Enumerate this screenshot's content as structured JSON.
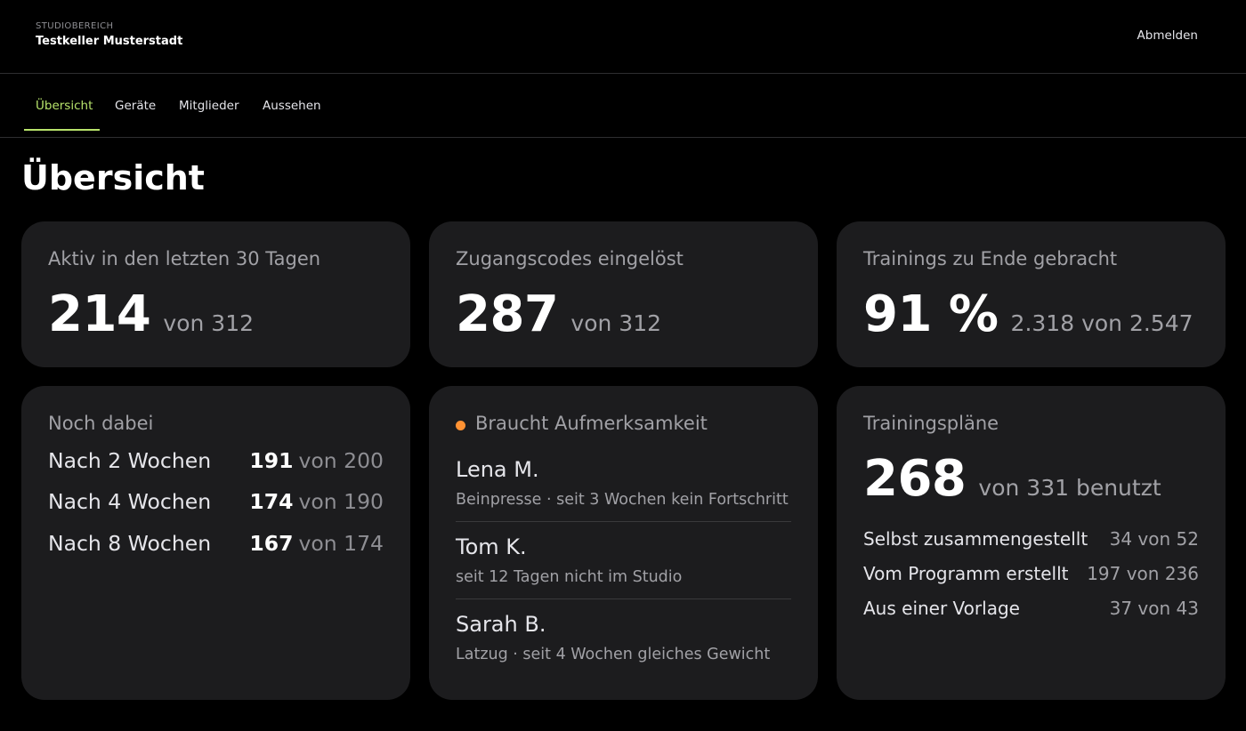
{
  "header": {
    "kicker": "STUDIOBEREICH",
    "studio_name": "Testkeller Musterstadt",
    "logout_label": "Abmelden"
  },
  "tabs": [
    {
      "label": "Übersicht",
      "active": true
    },
    {
      "label": "Geräte",
      "active": false
    },
    {
      "label": "Mitglieder",
      "active": false
    },
    {
      "label": "Aussehen",
      "active": false
    }
  ],
  "page_title": "Übersicht",
  "cards": {
    "active": {
      "label": "Aktiv in den letzten 30 Tagen",
      "value": "214",
      "sub": "von 312"
    },
    "codes": {
      "label": "Zugangscodes eingelöst",
      "value": "287",
      "sub": "von 312"
    },
    "trainings": {
      "label": "Trainings zu Ende gebracht",
      "value": "91 %",
      "sub": "2.318 von 2.547"
    },
    "retention": {
      "label": "Noch dabei",
      "rows": [
        {
          "label": "Nach 2 Wochen",
          "value": "191",
          "of": "von 200"
        },
        {
          "label": "Nach 4 Wochen",
          "value": "174",
          "of": "von 190"
        },
        {
          "label": "Nach 8 Wochen",
          "value": "167",
          "of": "von 174"
        }
      ]
    },
    "attention": {
      "label": "Braucht Aufmerksamkeit",
      "status_color": "#ff9233",
      "items": [
        {
          "name": "Lena M.",
          "note": "Beinpresse · seit 3 Wochen kein Fortschritt"
        },
        {
          "name": "Tom K.",
          "note": "seit 12 Tagen nicht im Studio"
        },
        {
          "name": "Sarah B.",
          "note": "Latzug · seit 4 Wochen gleiches Gewicht"
        }
      ]
    },
    "plans": {
      "label": "Trainingspläne",
      "value": "268",
      "sub": "von 331 benutzt",
      "rows": [
        {
          "label": "Selbst zusammengestellt",
          "value": "34 von 52"
        },
        {
          "label": "Vom Programm erstellt",
          "value": "197 von 236"
        },
        {
          "label": "Aus einer Vorlage",
          "value": "37 von 43"
        }
      ]
    }
  },
  "colors": {
    "accent": "#b7e36b",
    "card_bg": "#1c1c1e",
    "attention_dot": "#ff9233"
  }
}
